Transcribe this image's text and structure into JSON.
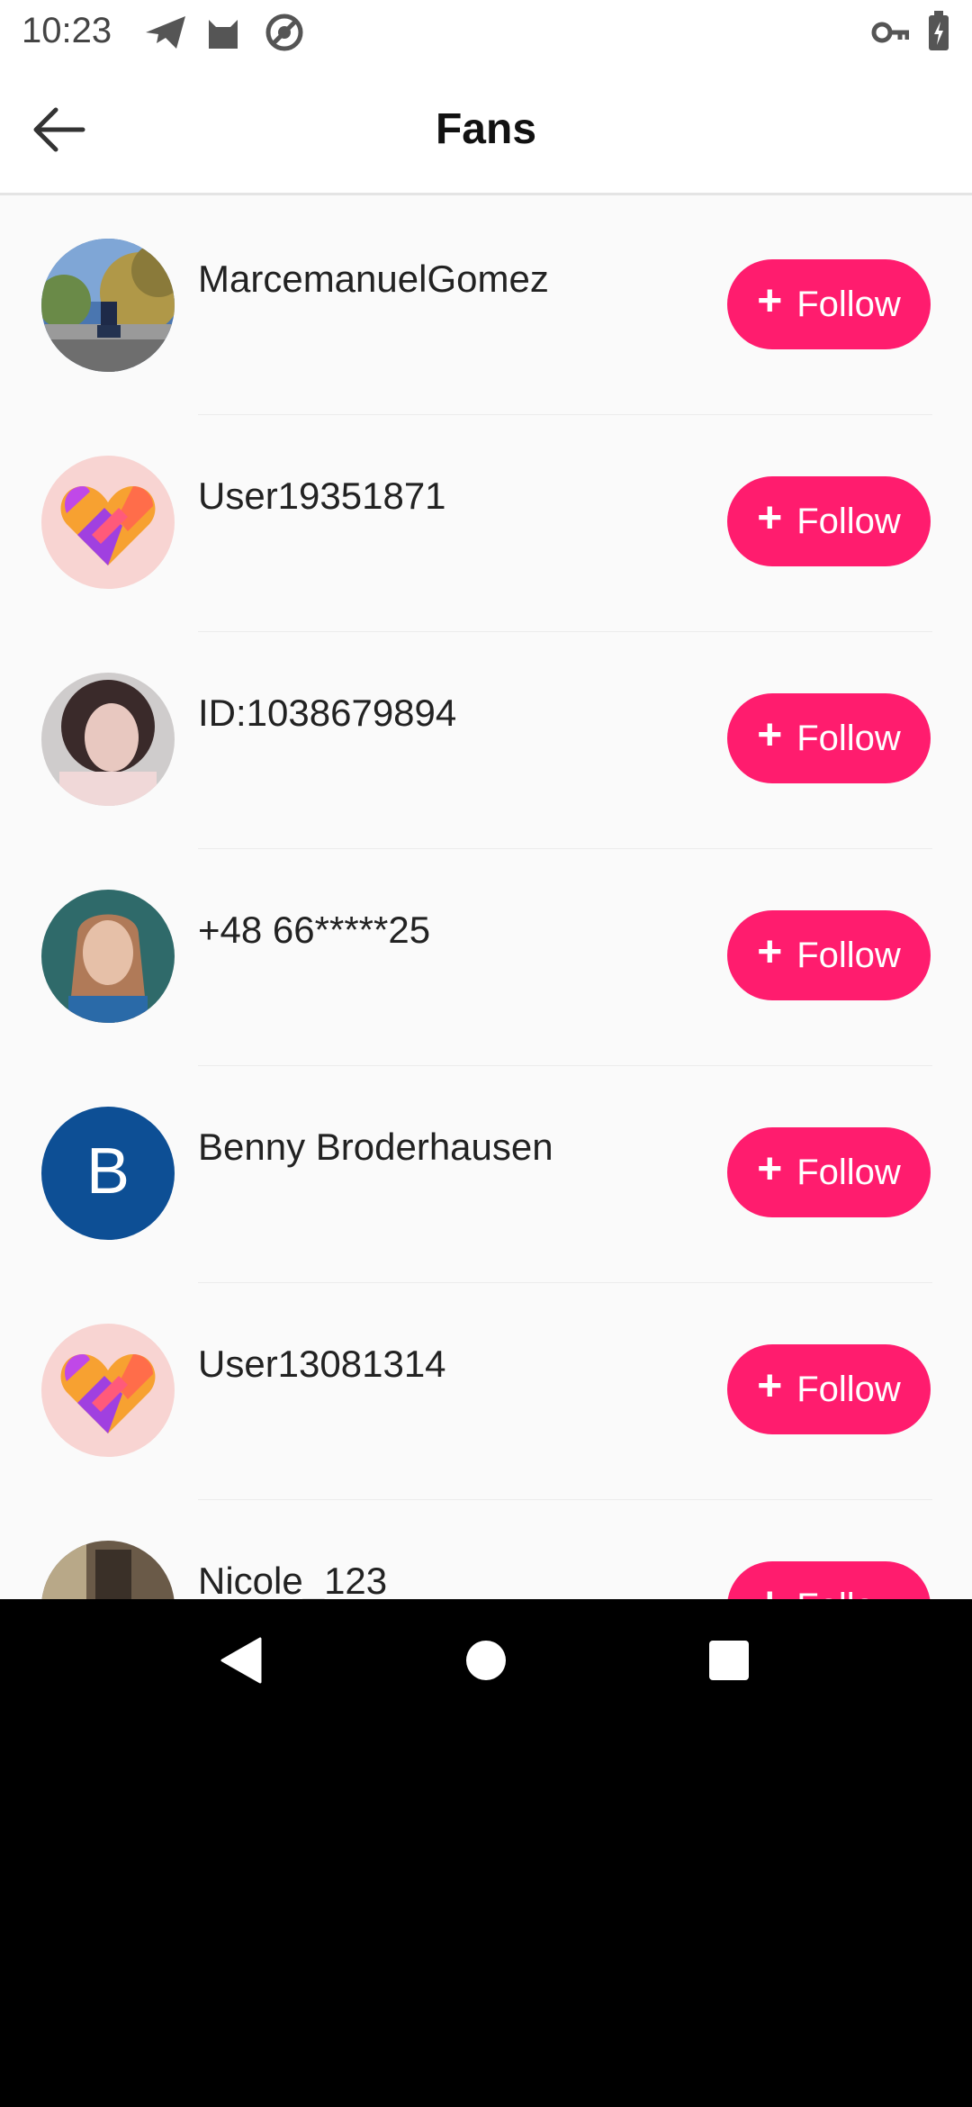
{
  "status_bar": {
    "time": "10:23",
    "icons_left": [
      "send-icon",
      "cat-icon",
      "at-sign-icon"
    ],
    "icons_right": [
      "vpn-key-icon",
      "battery-charging-icon"
    ]
  },
  "header": {
    "title": "Fans",
    "back_icon": "arrow-left-icon"
  },
  "fans": [
    {
      "name": "MarcemanuelGomez",
      "avatar": "photo-park"
    },
    {
      "name": "User19351871",
      "avatar": "heart-logo"
    },
    {
      "name": "ID:1038679894",
      "avatar": "photo-girl"
    },
    {
      "name": "+48 66*****25",
      "avatar": "photo-child"
    },
    {
      "name": "Benny Broderhausen",
      "avatar": "letter",
      "avatar_letter": "B"
    },
    {
      "name": "User13081314",
      "avatar": "heart-logo"
    },
    {
      "name": "Nicole_123",
      "avatar": "photo-room"
    }
  ],
  "follow_label": "Follow",
  "colors": {
    "accent": "#ff1c6e",
    "letter_avatar_bg": "#0d4f95"
  },
  "nav_bar": {
    "icons": [
      "back-triangle-icon",
      "home-circle-icon",
      "recents-square-icon"
    ]
  }
}
